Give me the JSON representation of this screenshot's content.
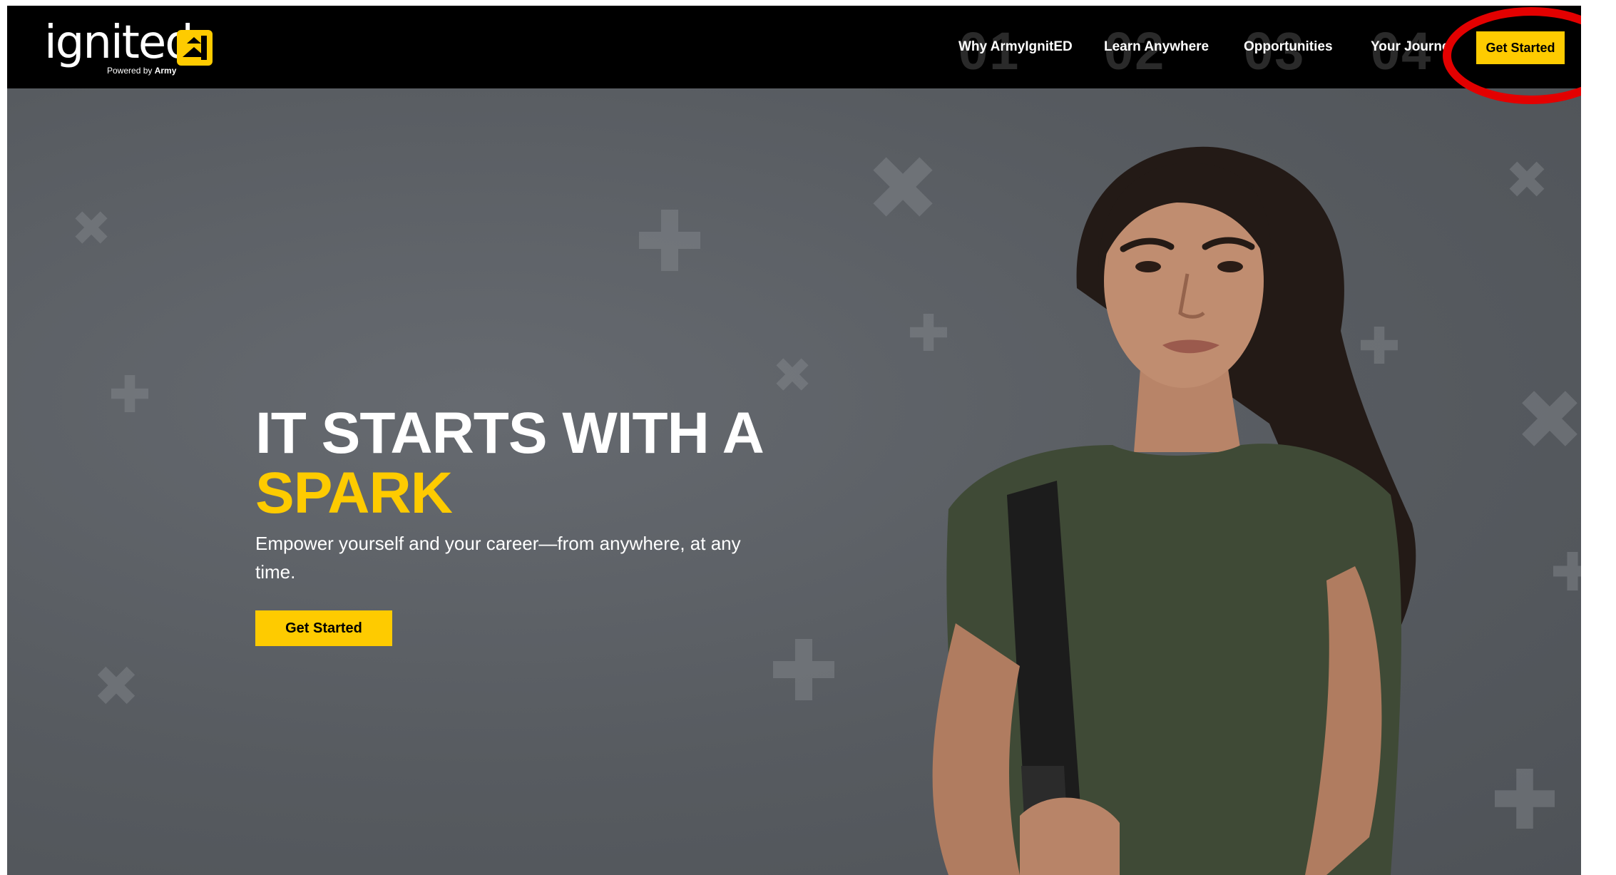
{
  "brand": {
    "logo_text": "ignited",
    "logo_sub_prefix": "Powered by",
    "logo_sub_brand": "Army",
    "accent_color": "#fecb00",
    "nav_background": "#000000"
  },
  "nav": {
    "items": [
      {
        "number": "01",
        "label": "Why ArmyIgnitED"
      },
      {
        "number": "02",
        "label": "Learn Anywhere"
      },
      {
        "number": "03",
        "label": "Opportunities"
      },
      {
        "number": "04",
        "label": "Your Journe"
      }
    ],
    "cta_label": "Get Started"
  },
  "hero": {
    "headline_line1": "IT STARTS WITH A",
    "headline_line2": "SPARK",
    "subtext": "Empower yourself and your career—from anywhere, at any time.",
    "cta_label": "Get Started"
  },
  "annotation": {
    "ring_color": "#e30000",
    "target": "nav-get-started-button"
  }
}
